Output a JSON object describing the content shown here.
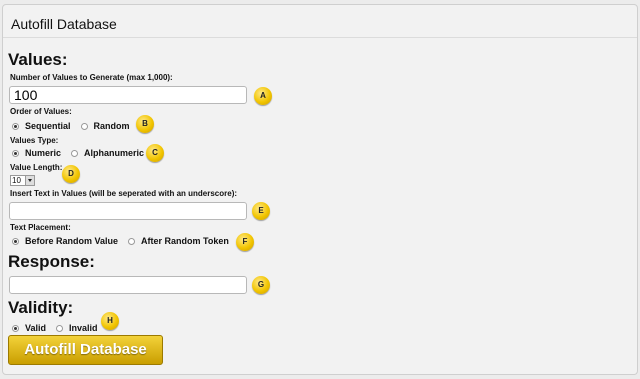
{
  "panel": {
    "title": "Autofill Database"
  },
  "values": {
    "heading": "Values:",
    "count_label": "Number of Values to Generate (max 1,000):",
    "count_value": "100",
    "order_label": "Order of Values:",
    "order_options": [
      "Sequential",
      "Random"
    ],
    "type_label": "Values Type:",
    "type_options": [
      "Numeric",
      "Alphanumeric"
    ],
    "length_label": "Value Length:",
    "length_value": "10",
    "insert_label": "Insert Text in Values (will be seperated with an underscore):",
    "insert_value": "",
    "placement_label": "Text Placement:",
    "placement_options": [
      "Before Random Value",
      "After Random Token"
    ]
  },
  "response": {
    "heading": "Response:",
    "value": ""
  },
  "validity": {
    "heading": "Validity:",
    "options": [
      "Valid",
      "Invalid"
    ]
  },
  "submit_label": "Autofill Database",
  "badges": [
    "A",
    "B",
    "C",
    "D",
    "E",
    "F",
    "G",
    "H"
  ],
  "colors": {
    "badge": "#f2c500",
    "button": "#d9b300",
    "background": "#f2f2f2"
  }
}
